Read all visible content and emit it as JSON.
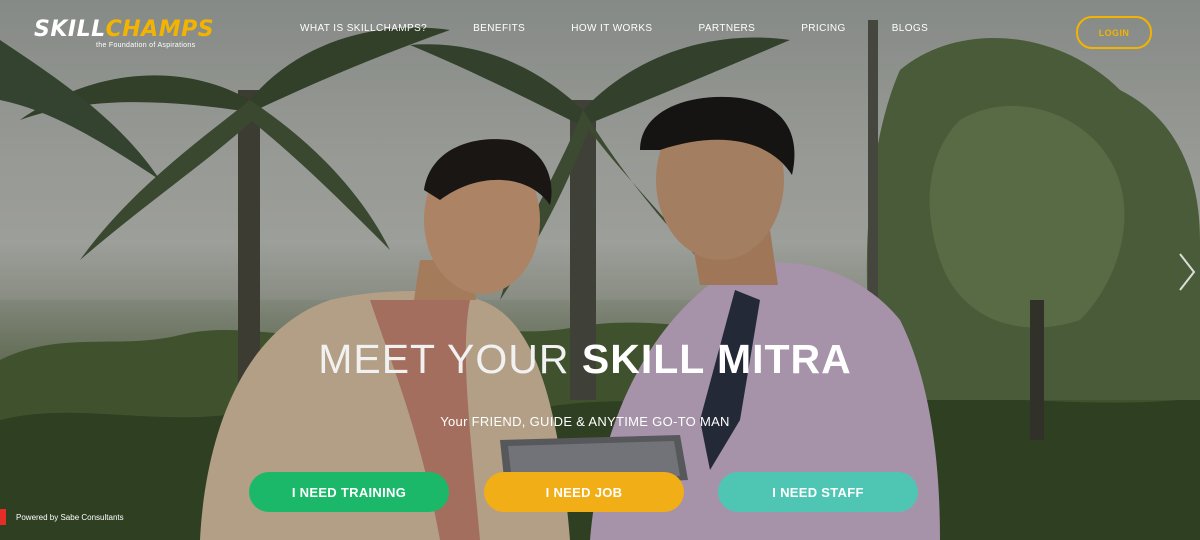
{
  "brand": {
    "logo_prefix": "SKILL",
    "logo_suffix": "CHAMPS",
    "tagline": "the Foundation of Aspirations"
  },
  "nav": {
    "items": [
      {
        "label": "WHAT IS SKILLCHAMPS?"
      },
      {
        "label": "BENEFITS"
      },
      {
        "label": "HOW IT WORKS"
      },
      {
        "label": "PARTNERS"
      },
      {
        "label": "PRICING"
      },
      {
        "label": "BLOGS"
      }
    ],
    "login_label": "LOGIN"
  },
  "hero": {
    "headline_light": "MEET YOUR",
    "headline_bold": "SKILL MITRA",
    "subline": "Your FRIEND, GUIDE & ANYTIME GO-TO MAN",
    "buttons": [
      {
        "label": "I NEED TRAINING"
      },
      {
        "label": "I NEED JOB"
      },
      {
        "label": "I NEED STAFF"
      }
    ],
    "slider_arrow_icon": "chevron-right-icon"
  },
  "footer": {
    "powered_by": "Powered by Sabe Consultants"
  },
  "colors": {
    "accent_yellow": "#f2b400",
    "training_green": "#1cb86a",
    "job_orange": "#f2ae16",
    "staff_teal": "#4fc6b4",
    "powered_red": "#e52d27"
  }
}
